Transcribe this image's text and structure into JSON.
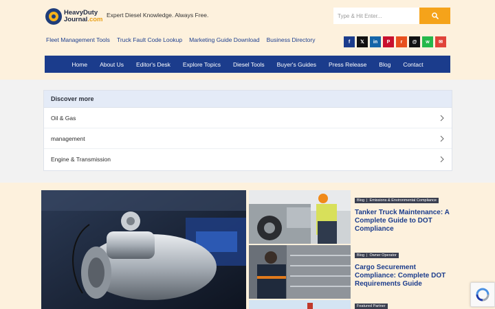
{
  "brand": {
    "logo_line1": "HeavyDuty",
    "logo_line2_main": "Journal",
    "logo_line2_suffix": ".com",
    "tagline": "Expert Diesel Knowledge. Always Free.",
    "accent_color": "#f5a31a",
    "nav_color": "#1b3c8c"
  },
  "search": {
    "placeholder": "Type & Hit Enter...",
    "button_icon": "search-icon"
  },
  "quick_links": [
    "Fleet Management Tools",
    "Truck Fault Code Lookup",
    "Marketing Guide Download",
    "Business Directory"
  ],
  "social": [
    {
      "name": "facebook-icon",
      "glyph": "f",
      "color": "#1b3c8c"
    },
    {
      "name": "x-twitter-icon",
      "glyph": "𝕏",
      "color": "#111111"
    },
    {
      "name": "linkedin-icon",
      "glyph": "in",
      "color": "#1565a8"
    },
    {
      "name": "pinterest-icon",
      "glyph": "P",
      "color": "#c8102e"
    },
    {
      "name": "reddit-icon",
      "glyph": "r",
      "color": "#e8501e"
    },
    {
      "name": "threads-icon",
      "glyph": "@",
      "color": "#111111"
    },
    {
      "name": "whatsapp-icon",
      "glyph": "w",
      "color": "#25b84b"
    },
    {
      "name": "email-icon",
      "glyph": "✉",
      "color": "#e0443a"
    }
  ],
  "nav": [
    "Home",
    "About Us",
    "Editor's Desk",
    "Explore Topics",
    "Diesel Tools",
    "Buyer's Guides",
    "Press Release",
    "Blog",
    "Contact"
  ],
  "discover": {
    "title": "Discover more",
    "items": [
      "Oil & Gas",
      "management",
      "Engine & Transmission"
    ]
  },
  "articles": [
    {
      "badges": [
        "Blog",
        "Emissions & Environmental Compliance"
      ],
      "title": "Tanker Truck Maintenance: A Complete Guide to DOT Compliance"
    },
    {
      "badges": [
        "Blog",
        "Owner Operator"
      ],
      "title": "Cargo Securement Compliance: Complete DOT Requirements Guide"
    },
    {
      "badges": [
        "Featured Partner"
      ],
      "title": ""
    }
  ]
}
